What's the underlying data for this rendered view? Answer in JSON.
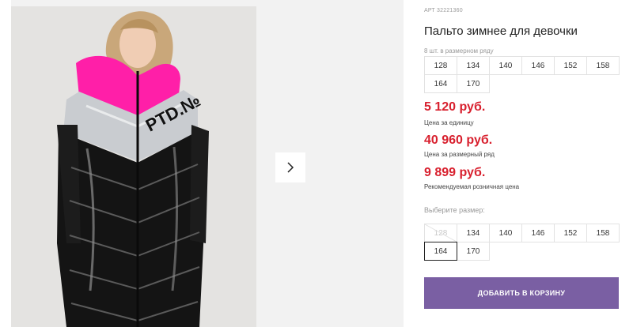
{
  "product": {
    "sku": "АРТ 32221360",
    "title": "Пальто зимнее для девочки"
  },
  "size_row": {
    "label": "8 шт. в размерном ряду",
    "sizes": [
      "128",
      "134",
      "140",
      "146",
      "152",
      "158",
      "164",
      "170"
    ]
  },
  "prices": [
    {
      "amount": "5 120 руб.",
      "caption": "Цена за единицу"
    },
    {
      "amount": "40 960 руб.",
      "caption": "Цена за размерный ряд"
    },
    {
      "amount": "9 899 руб.",
      "caption": "Рекомендуемая розничная цена"
    }
  ],
  "size_picker": {
    "label": "Выберите размер:",
    "options": [
      {
        "size": "128",
        "available": false
      },
      {
        "size": "134",
        "available": true
      },
      {
        "size": "140",
        "available": true
      },
      {
        "size": "146",
        "available": true
      },
      {
        "size": "152",
        "available": true
      },
      {
        "size": "158",
        "available": true
      },
      {
        "size": "164",
        "available": true,
        "selected": true
      },
      {
        "size": "170",
        "available": true
      }
    ]
  },
  "gallery": {
    "next_icon": "chevron-right-icon",
    "photo_text": "PTD.№"
  },
  "cart": {
    "button_label": "ДОБАВИТЬ В КОРЗИНУ"
  },
  "colors": {
    "price_red": "#d8202e",
    "cart_purple": "#7a5fa3",
    "jacket_pink": "#ff1fa8",
    "jacket_black": "#141414",
    "jacket_silver": "#c9ccd0"
  }
}
